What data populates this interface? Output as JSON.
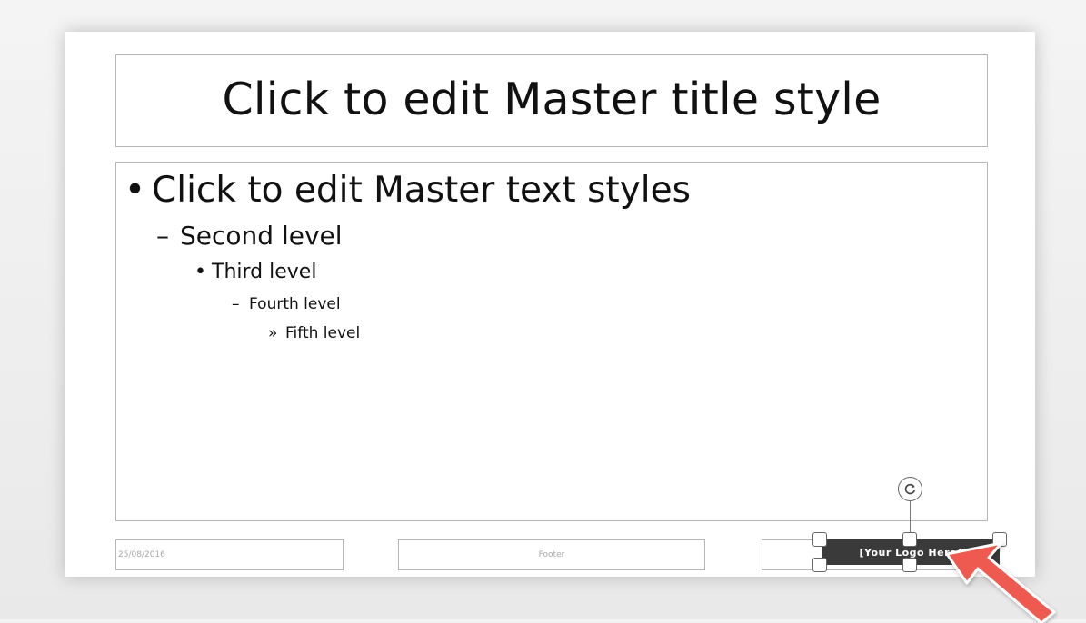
{
  "slide": {
    "title": "Click to edit Master title style",
    "body_levels": [
      {
        "bullet": "•",
        "text": "Click to edit Master text styles"
      },
      {
        "bullet": "–",
        "text": "Second level"
      },
      {
        "bullet": "•",
        "text": "Third level"
      },
      {
        "bullet": "–",
        "text": "Fourth level"
      },
      {
        "bullet": "»",
        "text": "Fifth level"
      }
    ],
    "footer": {
      "date": "25/08/2016",
      "center": "Footer"
    },
    "logo_text": "[Your Logo Here]"
  },
  "icons": {
    "rotate": "rotate-icon",
    "pointer": "arrow-pointer-icon"
  },
  "colors": {
    "logo_bg": "#3a3a3a",
    "arrow": "#ee5a4f"
  }
}
